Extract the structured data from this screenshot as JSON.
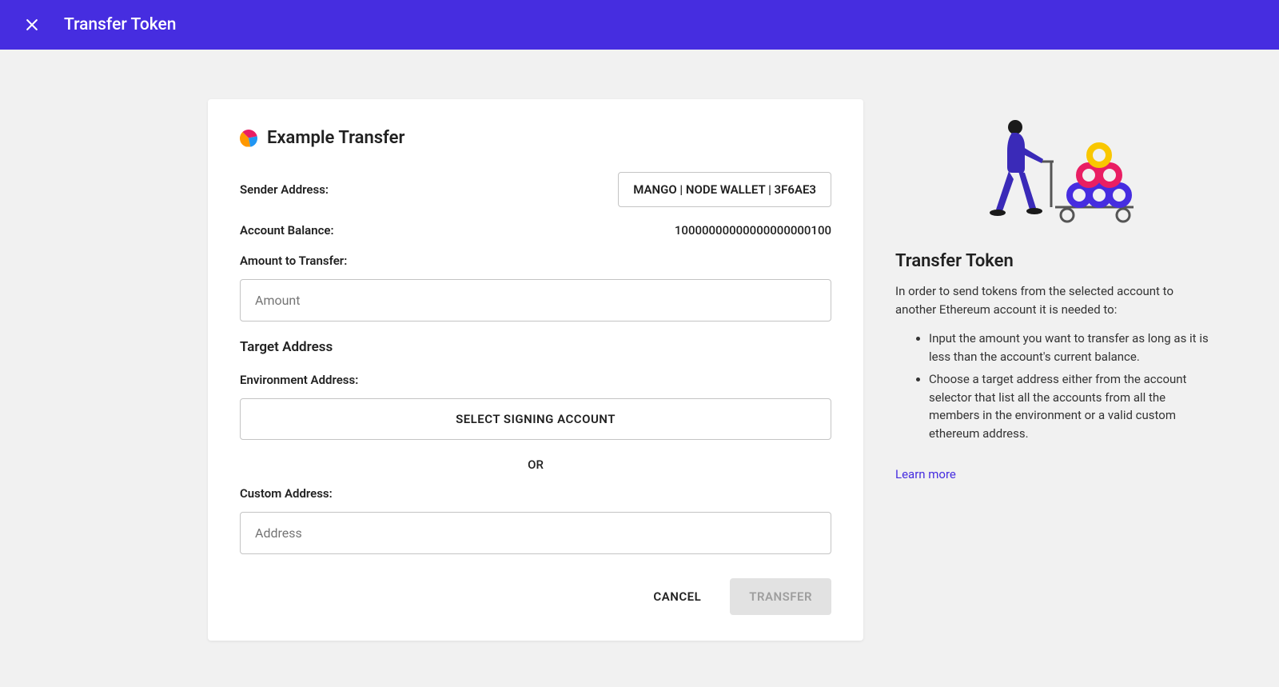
{
  "header": {
    "title": "Transfer Token"
  },
  "form": {
    "title": "Example Transfer",
    "sender_label": "Sender Address:",
    "sender_value": "MANGO | NODE WALLET | 3F6AE3",
    "balance_label": "Account Balance:",
    "balance_value": "10000000000000000000100",
    "amount_label": "Amount to Transfer:",
    "amount_placeholder": "Amount",
    "target_heading": "Target Address",
    "env_address_label": "Environment Address:",
    "select_account_label": "SELECT SIGNING ACCOUNT",
    "or_text": "OR",
    "custom_address_label": "Custom Address:",
    "custom_address_placeholder": "Address",
    "cancel_label": "CANCEL",
    "transfer_label": "TRANSFER"
  },
  "side": {
    "title": "Transfer Token",
    "desc": "In order to send tokens from the selected account to another Ethereum account it is needed to:",
    "bullets": [
      "Input the amount you want to transfer as long as it is less than the account's current balance.",
      "Choose a target address either from the account selector that list all the accounts from all the members in the environment or a valid custom ethereum address."
    ],
    "learn_more": "Learn more"
  }
}
